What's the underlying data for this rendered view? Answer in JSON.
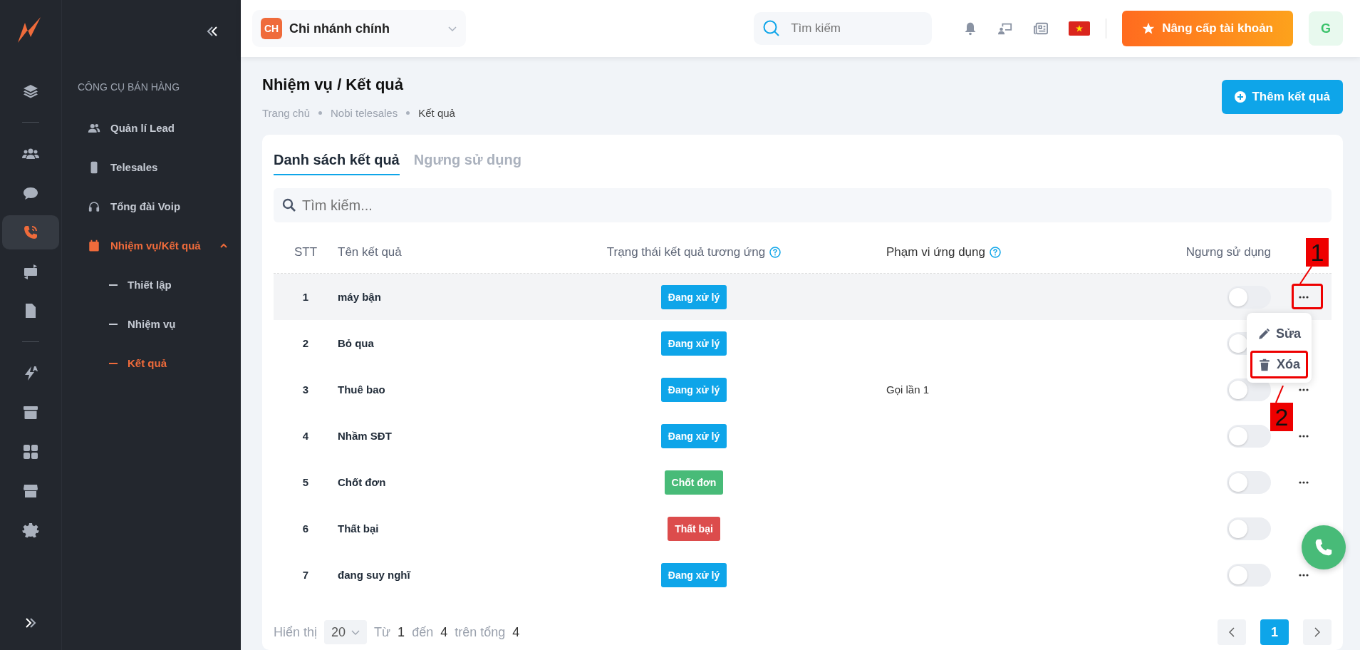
{
  "rail": {
    "items": [
      {
        "kind": "layers",
        "selected": false
      },
      {
        "kind": "divider"
      },
      {
        "kind": "users",
        "selected": false
      },
      {
        "kind": "chat",
        "selected": false
      },
      {
        "kind": "phone",
        "selected": true
      },
      {
        "kind": "money",
        "selected": false
      },
      {
        "kind": "document",
        "selected": false
      },
      {
        "kind": "divider"
      },
      {
        "kind": "bolt",
        "selected": false
      },
      {
        "kind": "archive",
        "selected": false
      },
      {
        "kind": "grid",
        "selected": false
      },
      {
        "kind": "store",
        "selected": false
      },
      {
        "kind": "settings",
        "selected": false
      }
    ]
  },
  "sidebar": {
    "section": "CÔNG CỤ BÁN HÀNG",
    "items": [
      {
        "label": "Quản lí Lead",
        "selected": false
      },
      {
        "label": "Telesales",
        "selected": false
      },
      {
        "label": "Tổng đài Voip",
        "selected": false
      },
      {
        "label": "Nhiệm vụ/Kết quả",
        "selected": true,
        "expanded": true,
        "children": [
          {
            "label": "Thiết lập",
            "selected": false
          },
          {
            "label": "Nhiệm vụ",
            "selected": false
          },
          {
            "label": "Kết quả",
            "selected": true
          }
        ]
      }
    ]
  },
  "topbar": {
    "branch": {
      "badge": "CH",
      "name": "Chi nhánh chính"
    },
    "search": {
      "placeholder": "Tìm kiếm"
    },
    "upgrade": "Nâng cấp tài khoản",
    "avatar": "G"
  },
  "page": {
    "title": "Nhiệm vụ / Kết quả",
    "breadcrumbs": [
      "Trang chủ",
      "Nobi telesales",
      "Kết quả"
    ],
    "add_button": "Thêm kết quả"
  },
  "tabs": [
    {
      "label": "Danh sách kết quả",
      "selected": true
    },
    {
      "label": "Ngưng sử dụng",
      "selected": false
    }
  ],
  "table_search": {
    "placeholder": "Tìm kiếm..."
  },
  "table": {
    "columns": [
      {
        "label": "STT",
        "help": false
      },
      {
        "label": "Tên kết quả",
        "help": false
      },
      {
        "label": "Trạng thái kết quả tương ứng",
        "help": true
      },
      {
        "label": "Phạm vi ứng dụng",
        "help": true
      },
      {
        "label": "Ngưng sử dụng",
        "help": false
      }
    ],
    "rows": [
      {
        "stt": "1",
        "name": "máy bận",
        "status": "Đang xử lý",
        "color": "#0ea5e9",
        "scope": "",
        "on": false,
        "hovered": true,
        "more": true
      },
      {
        "stt": "2",
        "name": "Bỏ qua",
        "status": "Đang xử lý",
        "color": "#0ea5e9",
        "scope": "",
        "on": false,
        "hovered": false,
        "more": false
      },
      {
        "stt": "3",
        "name": "Thuê bao",
        "status": "Đang xử lý",
        "color": "#0ea5e9",
        "scope": "Gọi lần 1",
        "on": false,
        "hovered": false,
        "more": true
      },
      {
        "stt": "4",
        "name": "Nhầm SĐT",
        "status": "Đang xử lý",
        "color": "#0ea5e9",
        "scope": "",
        "on": false,
        "hovered": false,
        "more": true
      },
      {
        "stt": "5",
        "name": "Chốt đơn",
        "status": "Chốt đơn",
        "color": "#48bb78",
        "scope": "",
        "on": false,
        "hovered": false,
        "more": true
      },
      {
        "stt": "6",
        "name": "Thất bại",
        "status": "Thất bại",
        "color": "#dc4c4c",
        "scope": "",
        "on": false,
        "hovered": false,
        "more": false
      },
      {
        "stt": "7",
        "name": "đang suy nghĩ",
        "status": "Đang xử lý",
        "color": "#0ea5e9",
        "scope": "",
        "on": false,
        "hovered": false,
        "more": true
      }
    ]
  },
  "row_menu": {
    "items": [
      {
        "label": "Sửa",
        "marked": false
      },
      {
        "label": "Xóa",
        "marked": true
      }
    ]
  },
  "annotations": [
    {
      "label": "1"
    },
    {
      "label": "2"
    }
  ],
  "pagination": {
    "show_label": "Hiển thị",
    "page_size": "20",
    "from_label": "Từ",
    "from": "1",
    "to_label": "đến",
    "to": "4",
    "total_label": "trên tổng",
    "total": "4",
    "pages": [
      {
        "label": "1",
        "selected": true
      }
    ]
  }
}
